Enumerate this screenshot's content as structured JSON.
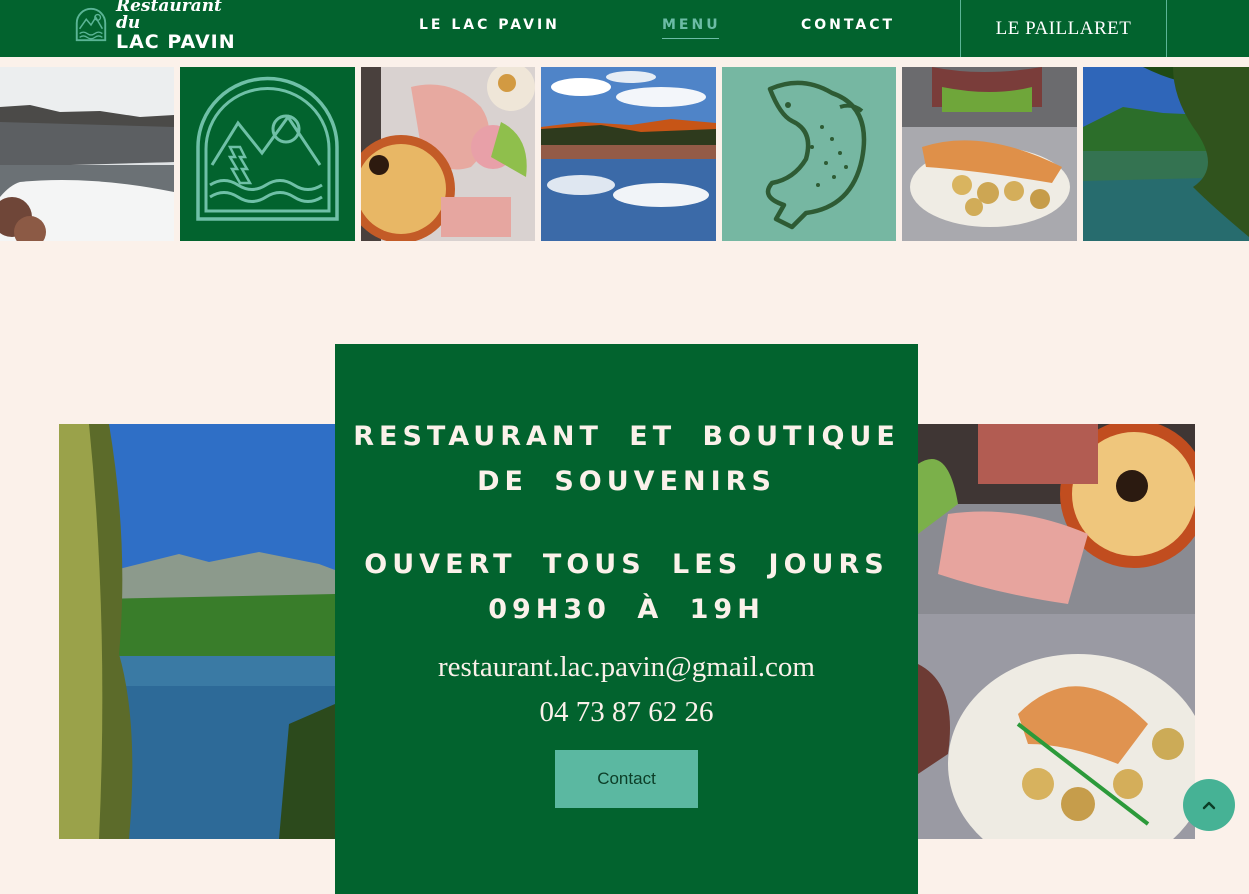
{
  "header": {
    "logo": {
      "script": "Restaurant du",
      "main": "LAC PAVIN"
    },
    "nav": [
      {
        "label": "LE LAC PAVIN"
      },
      {
        "label": "MENU",
        "active": true
      },
      {
        "label": "CONTACT"
      },
      {
        "label": "LE PAILLARET"
      }
    ]
  },
  "gallery": [
    {
      "name": "frozen-lake-photo"
    },
    {
      "name": "mountain-lake-logo-tile"
    },
    {
      "name": "charcuterie-truffade-photo"
    },
    {
      "name": "autumn-lake-reflection-photo"
    },
    {
      "name": "fish-illustration-tile"
    },
    {
      "name": "fish-plate-photo"
    },
    {
      "name": "summer-lake-photo"
    }
  ],
  "info": {
    "title": "RESTAURANT ET BOUTIQUE DE SOUVENIRS",
    "hours_line1": "OUVERT TOUS LES JOURS",
    "hours_line2": "09H30 À 19H",
    "email": "restaurant.lac.pavin@gmail.com",
    "phone": "04 73 87 62 26",
    "button": "Contact"
  },
  "colors": {
    "brand_green": "#02632e",
    "accent_teal": "#5bb8a1",
    "cream": "#fbf1ea"
  },
  "icons": {
    "scroll_top": "chevron-up-icon"
  }
}
